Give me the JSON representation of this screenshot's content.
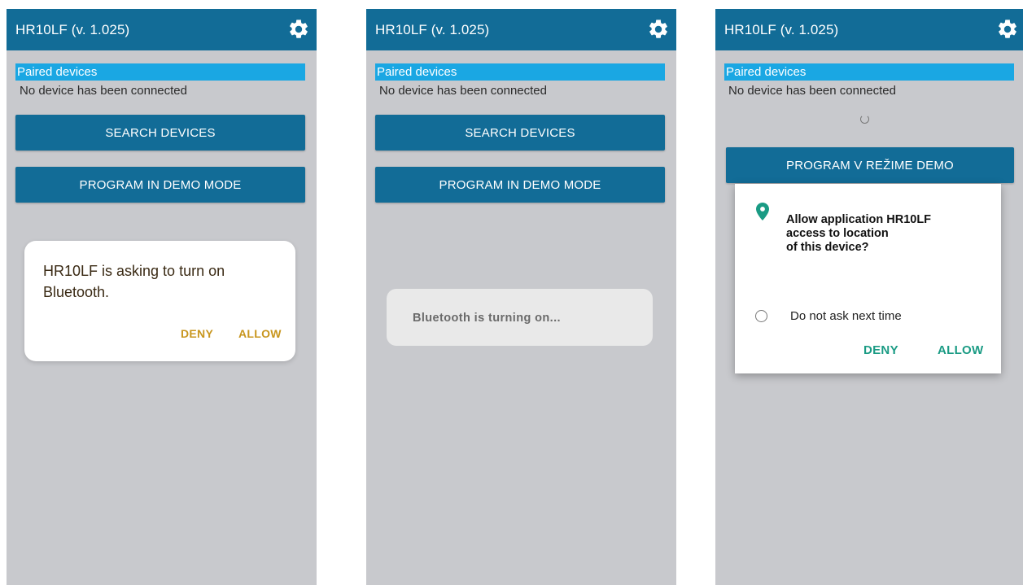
{
  "colors": {
    "appbar": "#126c97",
    "paired_header": "#1aa7e3",
    "screen_bg": "#c8c9cd",
    "bt_action": "#c8961e",
    "perm_action": "#1a9b84",
    "pin": "#1a9b84"
  },
  "icons": {
    "settings": "gear-icon",
    "location": "location-pin-icon",
    "loading": "spinner-icon"
  },
  "screens": [
    {
      "app_title": "HR10LF (v. 1.025)",
      "paired_label": "Paired devices",
      "no_device": "No device has been connected",
      "search_button": "SEARCH DEVICES",
      "demo_button": "PROGRAM IN DEMO MODE",
      "dialog": {
        "message": "HR10LF is asking to turn on Bluetooth.",
        "deny": "DENY",
        "allow": "ALLOW"
      }
    },
    {
      "app_title": "HR10LF (v. 1.025)",
      "paired_label": "Paired devices",
      "no_device": "No device has been connected",
      "search_button": "SEARCH DEVICES",
      "demo_button": "PROGRAM IN DEMO MODE",
      "toast": "Bluetooth is turning on..."
    },
    {
      "app_title": "HR10LF (v. 1.025)",
      "paired_label": "Paired devices",
      "no_device": "No device has been connected",
      "demo_button": "PROGRAM V REŽIME DEMO",
      "permission": {
        "title": "Allow application HR10LF\naccess to location\nof this device?",
        "checkbox_label": "Do not ask next time",
        "deny": "DENY",
        "allow": "ALLOW"
      }
    }
  ]
}
